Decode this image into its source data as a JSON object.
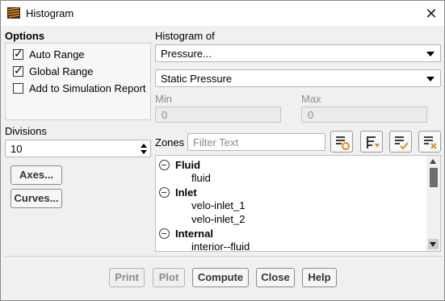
{
  "window": {
    "title": "Histogram",
    "icon": "histogram-app-icon",
    "close_glyph": "✕"
  },
  "options": {
    "title": "Options",
    "checkboxes": [
      {
        "label": "Auto Range",
        "checked": true
      },
      {
        "label": "Global Range",
        "checked": true
      },
      {
        "label": "Add to Simulation Report",
        "checked": false
      }
    ]
  },
  "histogram_of": {
    "title": "Histogram of",
    "category": "Pressure...",
    "field": "Static Pressure"
  },
  "range": {
    "min_label": "Min",
    "min_value": "0",
    "max_label": "Max",
    "max_value": "0"
  },
  "divisions": {
    "label": "Divisions",
    "value": "10"
  },
  "side_buttons": {
    "axes": "Axes...",
    "curves": "Curves..."
  },
  "zones": {
    "label": "Zones",
    "filter_placeholder": "Filter Text",
    "toolbar_icons": [
      "select-all-icon",
      "filter-selected-icon",
      "select-checked-icon",
      "deselect-all-icon"
    ],
    "groups": [
      {
        "name": "Fluid",
        "items": [
          "fluid"
        ]
      },
      {
        "name": "Inlet",
        "items": [
          "velo-inlet_1",
          "velo-inlet_2"
        ]
      },
      {
        "name": "Internal",
        "items": [
          "interior--fluid"
        ]
      }
    ]
  },
  "footer": {
    "print": "Print",
    "plot": "Plot",
    "compute": "Compute",
    "close": "Close",
    "help": "Help"
  },
  "colors": {
    "disabled_text": "#8c8c8c",
    "window_bg": "#f0f0f0"
  }
}
